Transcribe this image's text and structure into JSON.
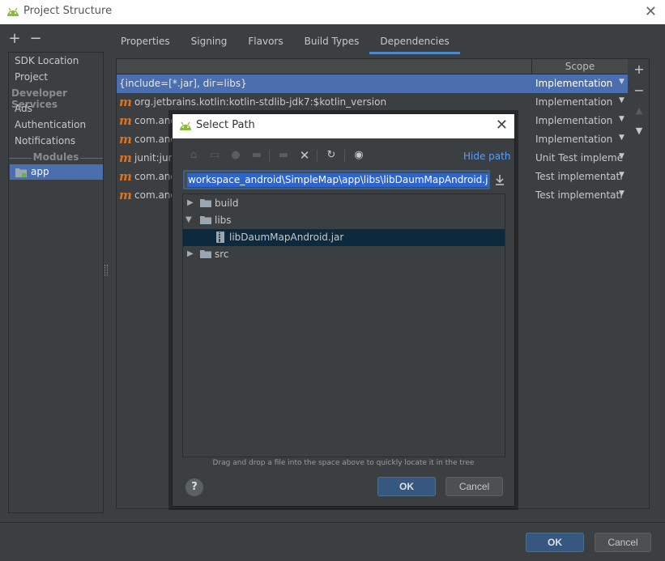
{
  "window": {
    "title": "Project Structure",
    "close_glyph": "✕"
  },
  "left_toolbar": {
    "add": "+",
    "remove": "−"
  },
  "left_nav": {
    "items": [
      "SDK Location",
      "Project"
    ],
    "section_dev": "Developer Services",
    "dev_items": [
      "Ads",
      "Authentication",
      "Notifications"
    ],
    "section_modules": "Modules",
    "module": "app"
  },
  "tabs": [
    "Properties",
    "Signing",
    "Flavors",
    "Build Types",
    "Dependencies"
  ],
  "deps": {
    "header_scope": "Scope",
    "rows": [
      {
        "name": "{include=[*.jar], dir=libs}",
        "scope": "Implementation"
      },
      {
        "name": "org.jetbrains.kotlin:kotlin-stdlib-jdk7:$kotlin_version",
        "scope": "Implementation"
      },
      {
        "name": "com.and",
        "scope": "Implementation"
      },
      {
        "name": "com.and",
        "scope": "Implementation"
      },
      {
        "name": "junit:juni",
        "scope": "Unit Test impleme…"
      },
      {
        "name": "com.and",
        "scope": "Test implementation"
      },
      {
        "name": "com.and",
        "scope": "Test implementation"
      }
    ]
  },
  "right_tools": {
    "add": "+",
    "remove": "−",
    "up": "▲",
    "down": "▼"
  },
  "dialog": {
    "title": "Select Path",
    "hide_path": "Hide path",
    "path_value": "workspace_android\\SimpleMap\\app\\libs\\libDaumMapAndroid.jar",
    "tree": [
      {
        "label": "build",
        "expanded": false
      },
      {
        "label": "libs",
        "expanded": true
      },
      {
        "label": "libDaumMapAndroid.jar",
        "child": true
      },
      {
        "label": "src",
        "expanded": false
      }
    ],
    "hint": "Drag and drop a file into the space above to quickly locate it in the tree",
    "help": "?",
    "ok": "OK",
    "cancel": "Cancel"
  },
  "footer": {
    "ok": "OK",
    "cancel": "Cancel"
  },
  "colors": {
    "accent": "#4b6eaf",
    "link": "#589df6",
    "maven": "#e0711b"
  }
}
